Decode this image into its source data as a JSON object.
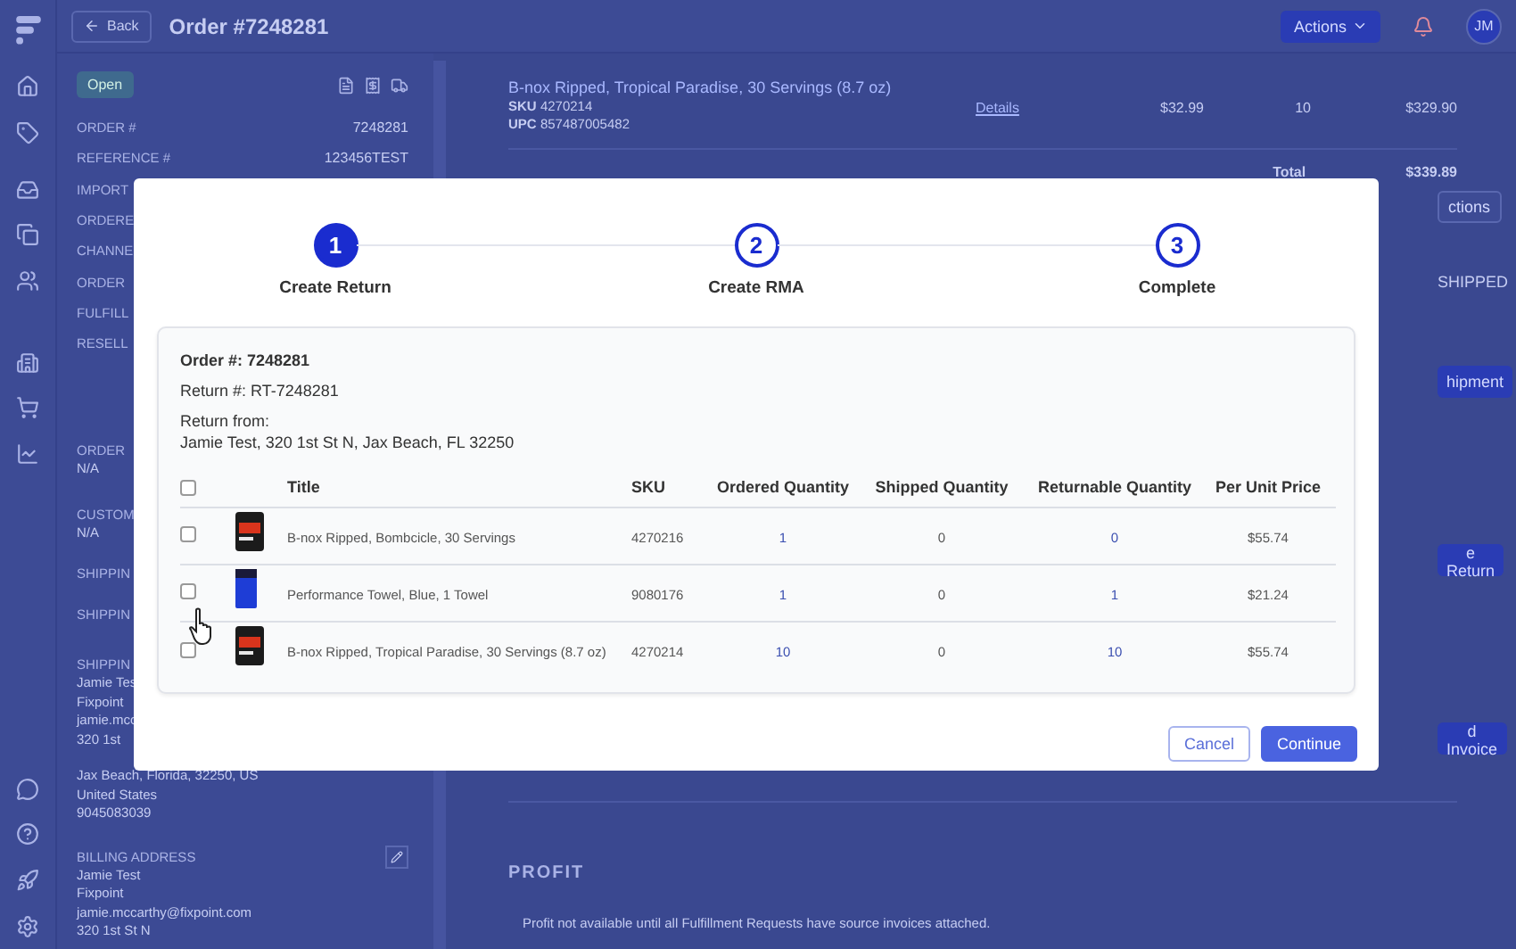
{
  "topbar": {
    "back": "Back",
    "title": "Order #7248281",
    "actions": "Actions",
    "avatar": "JM"
  },
  "order_panel": {
    "status": "Open",
    "fields": [
      {
        "label": "ORDER #",
        "value": "7248281"
      },
      {
        "label": "REFERENCE #",
        "value": "123456TEST"
      },
      {
        "label": "IMPORT"
      },
      {
        "label": "ORDERE"
      },
      {
        "label": "CHANNE"
      },
      {
        "label": "ORDER"
      },
      {
        "label": "FULFILL"
      },
      {
        "label": "RESELL"
      }
    ],
    "details": [
      {
        "label": "ORDER",
        "lines": [
          "N/A"
        ]
      },
      {
        "label": "CUSTOM",
        "lines": [
          "N/A"
        ]
      },
      {
        "label": "SHIPPIN"
      },
      {
        "label": "SHIPPIN"
      },
      {
        "label": "SHIPPIN",
        "lines": [
          "Jamie Tes",
          "Fixpoint",
          "jamie.mcc",
          "320 1st"
        ],
        "more_lines": [
          "Jax Beach, Florida, 32250, US",
          "United States",
          "9045083039"
        ]
      },
      {
        "label": "BILLING ADDRESS",
        "editable": true,
        "lines": [
          "Jamie Test",
          "Fixpoint",
          "jamie.mccarthy@fixpoint.com",
          "320 1st St N"
        ]
      }
    ]
  },
  "line_item": {
    "title": "B-nox Ripped, Tropical Paradise, 30 Servings (8.7 oz)",
    "sku_label": "SKU",
    "sku": "4270214",
    "upc_label": "UPC",
    "upc": "857487005482",
    "details": "Details",
    "price": "$32.99",
    "quantity": "10",
    "amount": "$329.90"
  },
  "total": {
    "label": "Total",
    "value": "$339.89"
  },
  "side_controls": [
    {
      "kind": "outline",
      "label": "ctions"
    },
    {
      "kind": "text",
      "label": "SHIPPED"
    },
    {
      "kind": "button",
      "label": "hipment"
    },
    {
      "kind": "button",
      "label": "e Return"
    },
    {
      "kind": "button",
      "label": "d Invoice"
    }
  ],
  "profit": {
    "title": "PROFIT",
    "message": "Profit not available until all Fulfillment Requests have source invoices attached."
  },
  "modal": {
    "steps": [
      {
        "number": "1",
        "label": "Create Return",
        "selected": true
      },
      {
        "number": "2",
        "label": "Create RMA",
        "selected": false
      },
      {
        "number": "3",
        "label": "Complete",
        "selected": false
      }
    ],
    "order": "Order #: 7248281",
    "return_number": "Return #: RT-7248281",
    "return_from_label": "Return from:",
    "return_from": "Jamie Test, 320 1st St N, Jax Beach, FL 32250",
    "table": {
      "select_all_checked": false,
      "columns": [
        "Title",
        "SKU",
        "Ordered Quantity",
        "Shipped Quantity",
        "Returnable Quantity",
        "Per Unit Price"
      ],
      "rows": [
        {
          "kind": "tub",
          "checked": false,
          "title": "B-nox Ripped, Bombcicle, 30 Servings",
          "sku": "4270216",
          "ordered": "1",
          "shipped": "0",
          "returnable": "0",
          "price": "$55.74"
        },
        {
          "kind": "towel",
          "checked": false,
          "title": "Performance Towel, Blue, 1 Towel",
          "sku": "9080176",
          "ordered": "1",
          "shipped": "0",
          "returnable": "1",
          "price": "$21.24"
        },
        {
          "kind": "tub",
          "checked": false,
          "title": "B-nox Ripped, Tropical Paradise, 30 Servings (8.7 oz)",
          "sku": "4270214",
          "ordered": "10",
          "shipped": "0",
          "returnable": "10",
          "price": "$55.74"
        }
      ]
    },
    "buttons": [
      {
        "kind": "secondary",
        "label": "Cancel"
      },
      {
        "kind": "primary",
        "label": "Continue"
      }
    ]
  }
}
